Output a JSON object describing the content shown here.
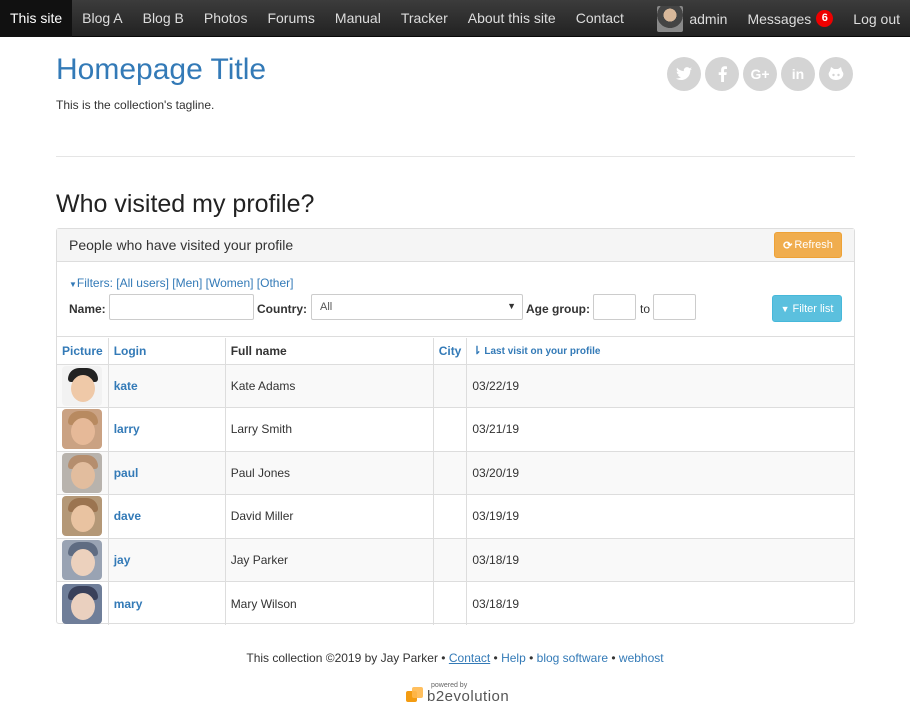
{
  "nav": {
    "items": [
      "This site",
      "Blog A",
      "Blog B",
      "Photos",
      "Forums",
      "Manual",
      "Tracker",
      "About this site",
      "Contact"
    ],
    "user": "admin",
    "messages_label": "Messages",
    "messages_count": "6",
    "logout": "Log out"
  },
  "header": {
    "title": "Homepage Title",
    "tagline": "This is the collection's tagline.",
    "social": [
      "twitter-icon",
      "facebook-icon",
      "google-plus-icon",
      "linkedin-icon",
      "github-icon"
    ]
  },
  "page_title": "Who visited my profile?",
  "panel": {
    "heading": "People who have visited your profile",
    "refresh_label": "Refresh",
    "filters": {
      "toggle": "Filters:",
      "all_users": "[All users]",
      "men": "[Men]",
      "women": "[Women]",
      "other": "[Other]",
      "name_label": "Name:",
      "name_value": "",
      "country_label": "Country:",
      "country_value": "All",
      "age_label": "Age group:",
      "to_label": "to",
      "filter_button": "Filter list"
    },
    "columns": [
      "Picture",
      "Login",
      "Full name",
      "City",
      "Last visit on your profile"
    ],
    "rows": [
      {
        "login": "kate",
        "full_name": "Kate Adams",
        "city": "",
        "last_visit": "03/22/19"
      },
      {
        "login": "larry",
        "full_name": "Larry Smith",
        "city": "",
        "last_visit": "03/21/19"
      },
      {
        "login": "paul",
        "full_name": "Paul Jones",
        "city": "",
        "last_visit": "03/20/19"
      },
      {
        "login": "dave",
        "full_name": "David Miller",
        "city": "",
        "last_visit": "03/19/19"
      },
      {
        "login": "jay",
        "full_name": "Jay Parker",
        "city": "",
        "last_visit": "03/18/19"
      },
      {
        "login": "mary",
        "full_name": "Mary Wilson",
        "city": "",
        "last_visit": "03/18/19"
      }
    ]
  },
  "footer": {
    "text": "This collection ©2019 by Jay Parker •",
    "contact": "Contact",
    "help": "Help",
    "blog_software": "blog software",
    "webhost": "webhost",
    "powered_by": "powered by",
    "brand": "b2evolution"
  },
  "colors": {
    "link": "#337ab7",
    "refresh_button": "#f0ad4e",
    "filter_button": "#5bc0de",
    "badge": "#ee0000"
  }
}
